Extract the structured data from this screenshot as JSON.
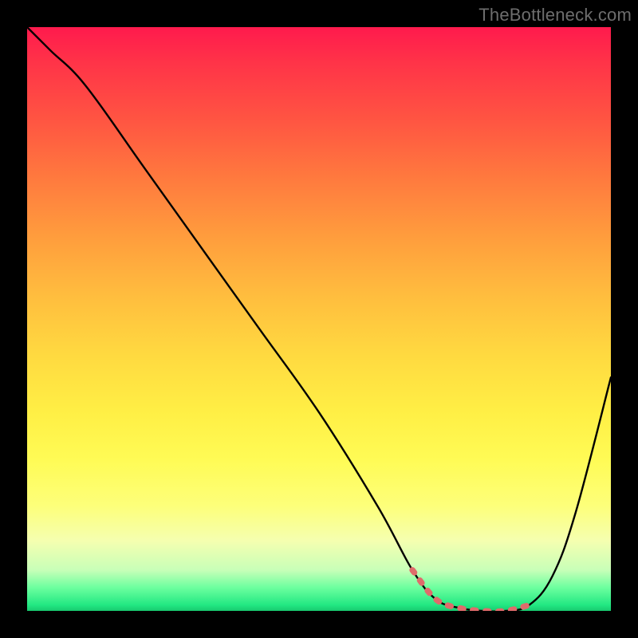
{
  "watermark": "TheBottleneck.com",
  "colors": {
    "page_bg": "#000000",
    "curve_stroke": "#000000",
    "mask_stroke": "#e06666",
    "gradient_top": "#ff1a4d",
    "gradient_bottom": "#18c96f"
  },
  "chart_data": {
    "type": "line",
    "title": "",
    "xlabel": "",
    "ylabel": "",
    "xlim": [
      0,
      100
    ],
    "ylim": [
      0,
      100
    ],
    "grid": false,
    "legend": false,
    "annotations": [],
    "series": [
      {
        "name": "curve",
        "x": [
          0,
          4,
          10,
          20,
          30,
          40,
          50,
          60,
          66,
          70,
          74,
          78,
          82,
          86,
          90,
          94,
          100
        ],
        "y": [
          100,
          96,
          90,
          76,
          62,
          48,
          34,
          18,
          7,
          2,
          0.5,
          0,
          0,
          1,
          6,
          17,
          40
        ]
      },
      {
        "name": "flat-bottom-highlight",
        "x": [
          66,
          70,
          74,
          78,
          82,
          86
        ],
        "y": [
          7,
          2,
          0.5,
          0,
          0,
          1
        ]
      }
    ]
  }
}
